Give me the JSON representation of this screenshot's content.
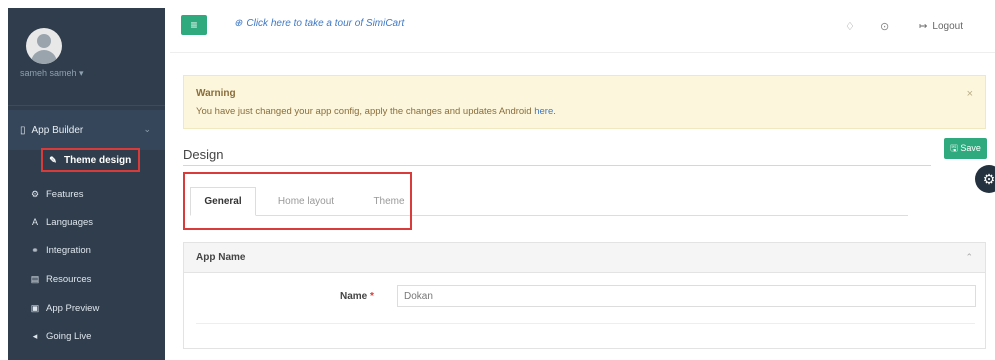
{
  "sidebar": {
    "username": "sameh sameh ▾",
    "app_builder": {
      "label": "App Builder",
      "chevron": "⌄"
    },
    "items": [
      {
        "label": "Theme design",
        "icon": "pencil-icon",
        "glyph": "✎"
      },
      {
        "label": "Features",
        "icon": "settings-icon",
        "glyph": "⚙"
      },
      {
        "label": "Languages",
        "icon": "translate-icon",
        "glyph": "A"
      },
      {
        "label": "Integration",
        "icon": "integration-icon",
        "glyph": "⚭"
      },
      {
        "label": "Resources",
        "icon": "resources-icon",
        "glyph": "▤"
      },
      {
        "label": "App Preview",
        "icon": "preview-icon",
        "glyph": "▣"
      },
      {
        "label": "Going Live",
        "icon": "broadcast-icon",
        "glyph": "◂"
      }
    ]
  },
  "topbar": {
    "menu_glyph": "≡",
    "tour_text": "Click here to take a tour of SimiCart",
    "logout_label": "Logout",
    "bell_glyph": "♢",
    "settings_glyph": "⊙",
    "logout_glyph": "↦"
  },
  "warning": {
    "title": "Warning",
    "message": "You have just changed your app config, apply the changes and updates Android",
    "link_text": "here",
    "close_glyph": "×"
  },
  "design": {
    "title": "Design",
    "save_label": "Save",
    "save_glyph": "🖫"
  },
  "tabs": [
    "General",
    "Home layout",
    "Theme"
  ],
  "panel": {
    "title": "App Name",
    "caret": "⌃",
    "field_label": "Name",
    "required_mark": "*",
    "field_value": "Dokan"
  },
  "colors": {
    "sidebar_bg": "#2f3d4c",
    "accent_green": "#2eaa7e",
    "warning_bg": "#fcf6dc",
    "highlight_red": "#d93a3a",
    "link_blue": "#3f78c4"
  }
}
